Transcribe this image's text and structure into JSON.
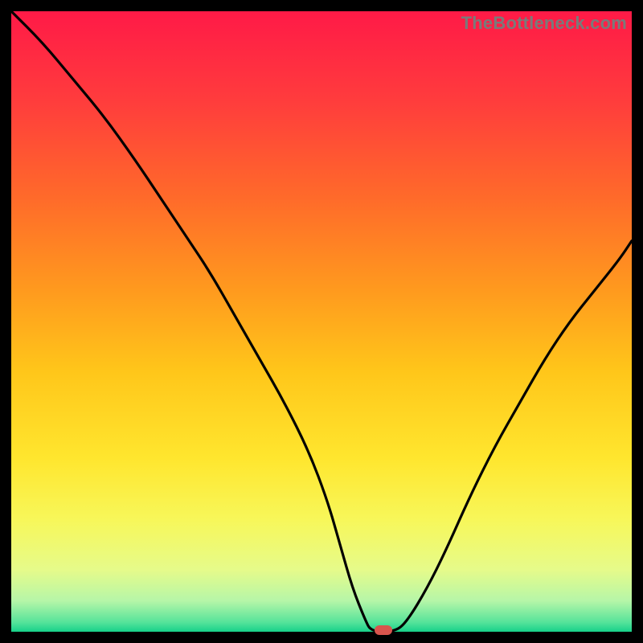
{
  "watermark": "TheBottleneck.com",
  "colors": {
    "frame": "#000000",
    "marker": "#d9544d",
    "curve": "#000000"
  },
  "chart_data": {
    "type": "line",
    "title": "",
    "xlabel": "",
    "ylabel": "",
    "xlim": [
      0,
      100
    ],
    "ylim": [
      0,
      100
    ],
    "grid": false,
    "legend": false,
    "gradient_stops": [
      {
        "pos": 0.0,
        "color": "#ff1a47"
      },
      {
        "pos": 0.14,
        "color": "#ff3b3d"
      },
      {
        "pos": 0.3,
        "color": "#ff6a2a"
      },
      {
        "pos": 0.45,
        "color": "#ff9a1e"
      },
      {
        "pos": 0.58,
        "color": "#ffc61a"
      },
      {
        "pos": 0.72,
        "color": "#ffe62e"
      },
      {
        "pos": 0.82,
        "color": "#f7f75a"
      },
      {
        "pos": 0.9,
        "color": "#e6fb8a"
      },
      {
        "pos": 0.95,
        "color": "#b6f6a8"
      },
      {
        "pos": 0.985,
        "color": "#55e39a"
      },
      {
        "pos": 1.0,
        "color": "#17d18a"
      }
    ],
    "series": [
      {
        "name": "bottleneck-curve",
        "x": [
          0,
          5,
          10,
          15,
          20,
          24,
          28,
          32,
          36,
          40,
          44,
          48,
          51,
          53,
          55,
          57,
          58,
          62,
          64,
          67,
          70,
          74,
          78,
          82,
          86,
          90,
          94,
          98,
          100
        ],
        "y": [
          100,
          95,
          89,
          83,
          76,
          70,
          64,
          58,
          51,
          44,
          37,
          29,
          21,
          14,
          7,
          2,
          0,
          0,
          2,
          7,
          13,
          22,
          30,
          37,
          44,
          50,
          55,
          60,
          63
        ]
      }
    ],
    "marker": {
      "x": 60,
      "y": 0
    }
  }
}
